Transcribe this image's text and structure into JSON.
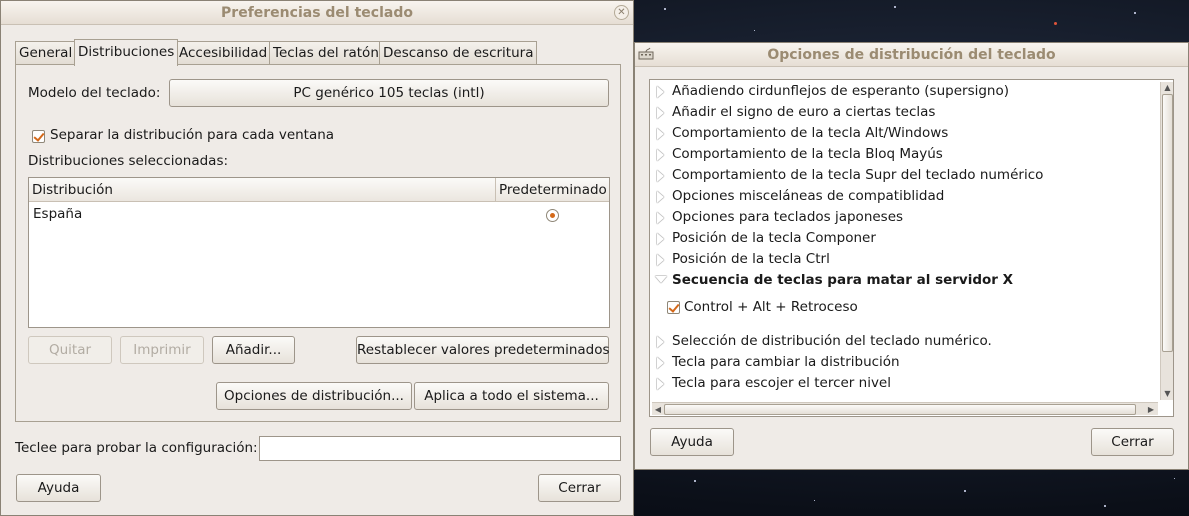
{
  "keyboard_prefs": {
    "title": "Preferencias del teclado",
    "tabs": [
      {
        "label": "General"
      },
      {
        "label": "Distribuciones"
      },
      {
        "label": "Accesibilidad"
      },
      {
        "label": "Teclas del ratón"
      },
      {
        "label": "Descanso de escritura"
      }
    ],
    "active_tab": "Distribuciones",
    "model_label": "Modelo del teclado:",
    "model_value": "PC genérico 105 teclas (intl)",
    "separate_layout_label": "Separar la distribución para cada ventana",
    "separate_layout_checked": true,
    "selected_layouts_label": "Distribuciones seleccionadas:",
    "table": {
      "columns": [
        "Distribución",
        "Predeterminado"
      ],
      "rows": [
        {
          "layout": "España",
          "default": true
        }
      ]
    },
    "buttons": {
      "remove": "Quitar",
      "print": "Imprimir",
      "add": "Añadir...",
      "reset": "Restablecer valores predeterminados",
      "layout_options": "Opciones de distribución...",
      "apply_system": "Aplica a todo el sistema...",
      "help": "Ayuda",
      "close": "Cerrar"
    },
    "test_label": "Teclee para probar la configuración:",
    "test_value": ""
  },
  "layout_options": {
    "title": "Opciones de distribución del teclado",
    "items_before": [
      "Añadiendo cirdunflejos de esperanto (supersigno)",
      "Añadir el signo de euro a ciertas teclas",
      "Comportamiento de la tecla Alt/Windows",
      "Comportamiento de la tecla Bloq Mayús",
      "Comportamiento de la tecla Supr del teclado numérico",
      "Opciones misceláneas de compatiblidad",
      "Opciones para teclados japoneses",
      "Posición de la tecla Componer",
      "Posición de la tecla Ctrl"
    ],
    "expanded_item": "Secuencia de teclas para matar al servidor X",
    "expanded_child": "Control + Alt + Retroceso",
    "expanded_child_checked": true,
    "items_after": [
      "Selección de distribución del teclado numérico.",
      "Tecla para cambiar la distribución",
      "Tecla para escojer el tercer nivel"
    ],
    "buttons": {
      "help": "Ayuda",
      "close": "Cerrar"
    },
    "colors": {
      "accent": "#d4691a",
      "title": "#9b8b72"
    }
  }
}
